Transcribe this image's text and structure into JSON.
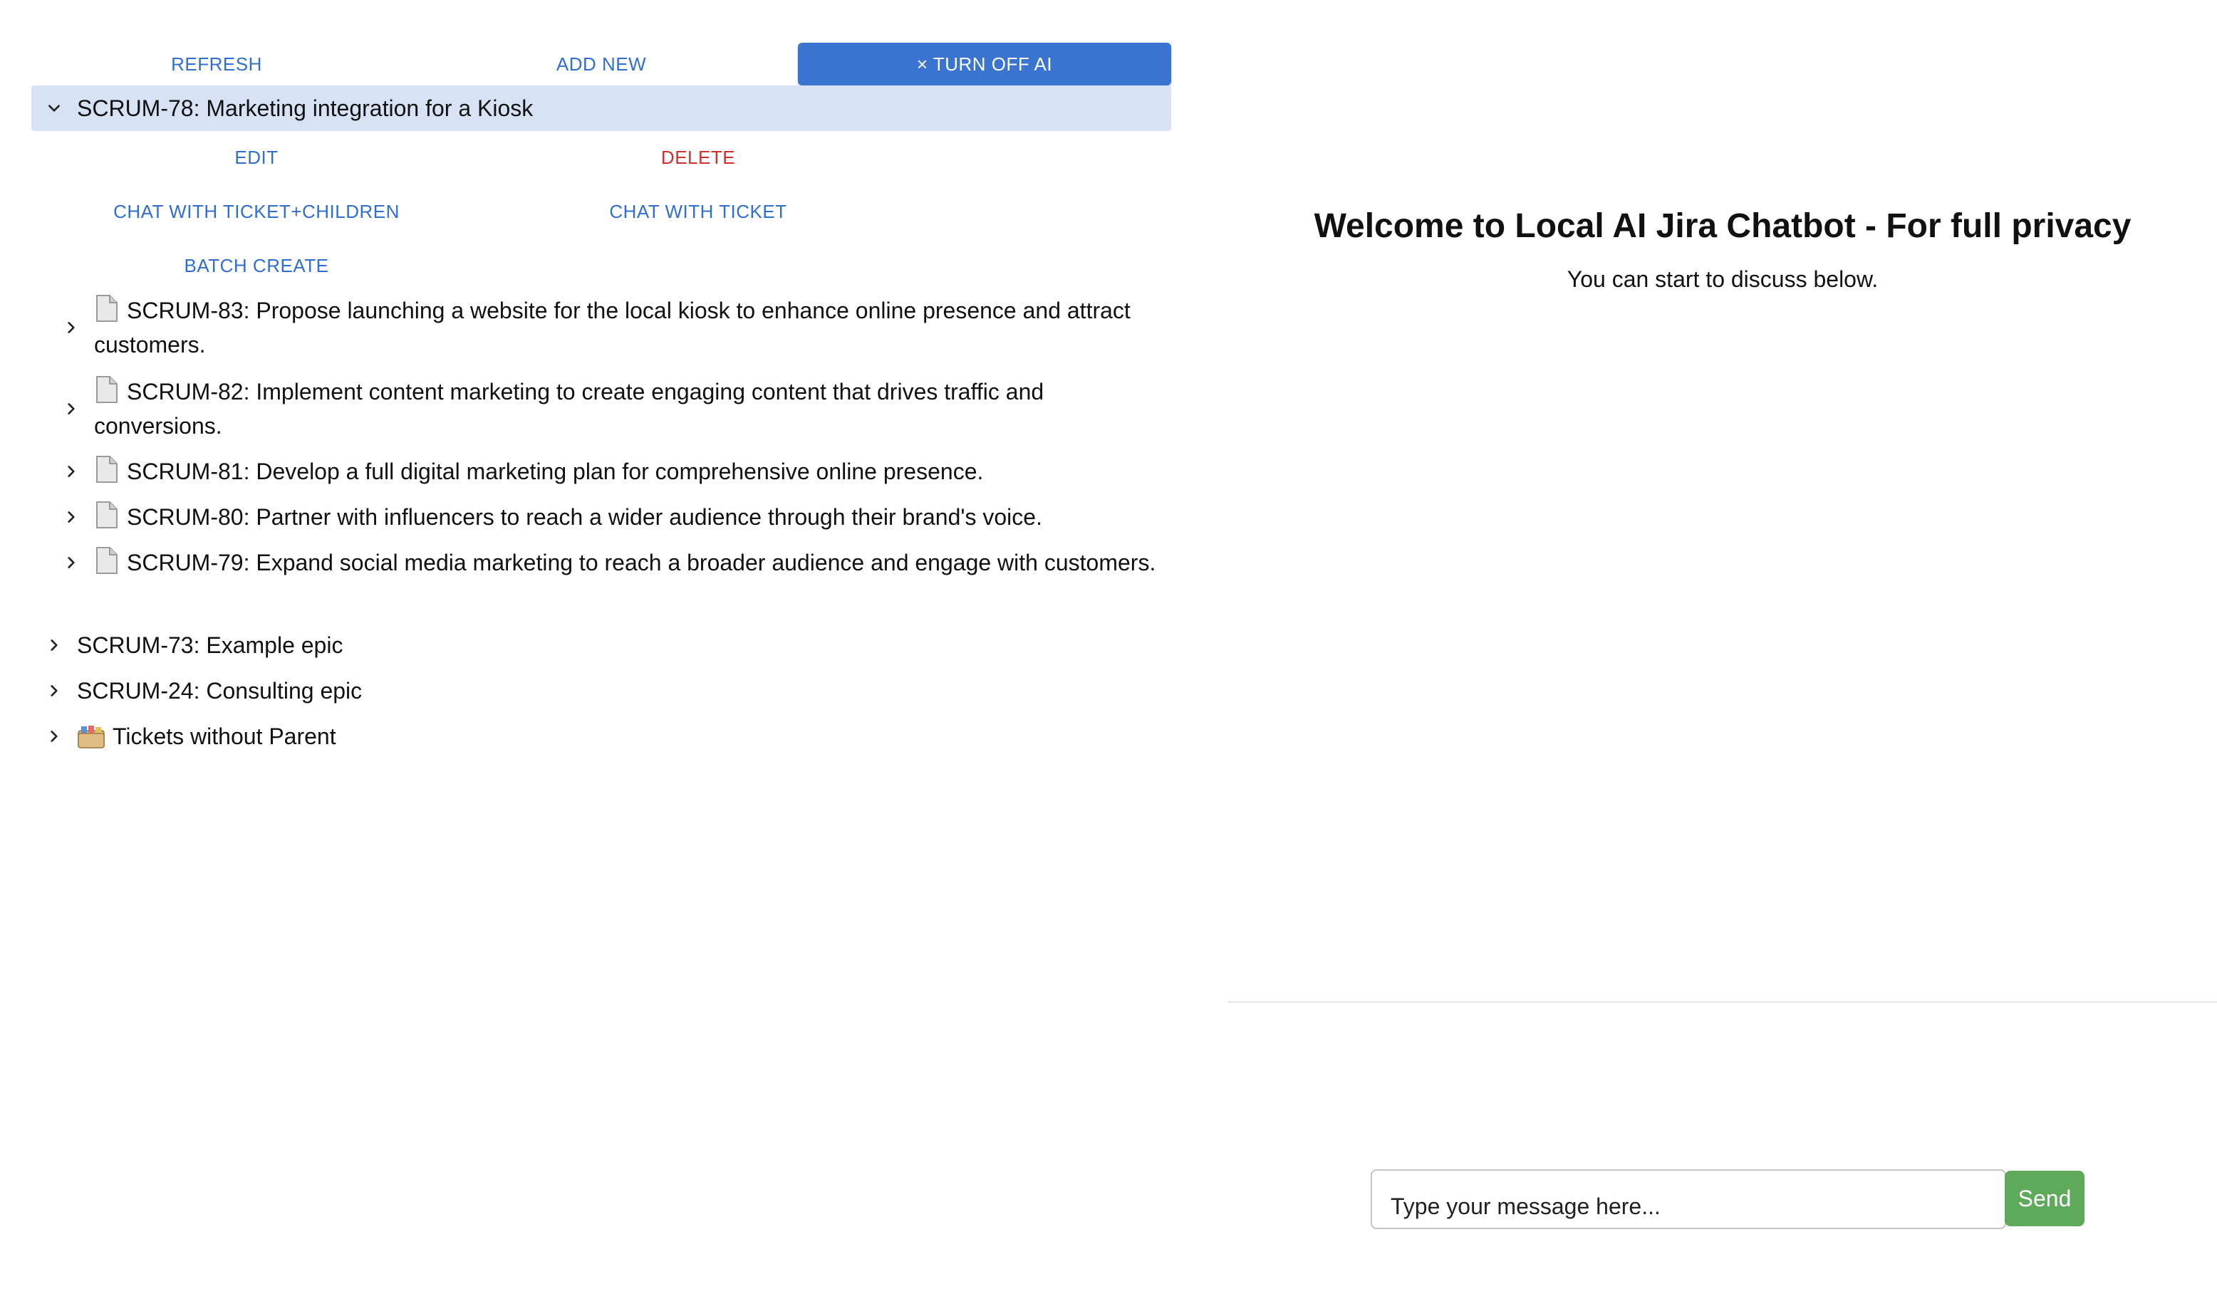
{
  "toolbar": {
    "refresh_label": "REFRESH",
    "add_new_label": "ADD NEW",
    "turn_off_ai_label": "× TURN OFF AI"
  },
  "tree": {
    "selected_epic": {
      "label": "SCRUM-78: Marketing integration for a Kiosk",
      "actions": {
        "edit": "EDIT",
        "delete": "DELETE",
        "chat_children": "CHAT WITH TICKET+CHILDREN",
        "chat_ticket": "CHAT WITH TICKET",
        "batch_create": "BATCH CREATE"
      },
      "children": [
        {
          "label": "SCRUM-83: Propose launching a website for the local kiosk to enhance online presence and attract customers."
        },
        {
          "label": "SCRUM-82: Implement content marketing to create engaging content that drives traffic and conversions."
        },
        {
          "label": "SCRUM-81: Develop a full digital marketing plan for comprehensive online presence."
        },
        {
          "label": "SCRUM-80: Partner with influencers to reach a wider audience through their brand's voice."
        },
        {
          "label": "SCRUM-79: Expand social media marketing to reach a broader audience and engage with customers."
        }
      ]
    },
    "other_epics": [
      {
        "label": "SCRUM-73: Example epic"
      },
      {
        "label": "SCRUM-24: Consulting epic"
      },
      {
        "label": "Tickets without Parent",
        "icon": "folder-icon"
      }
    ]
  },
  "chat": {
    "title": "Welcome to Local AI Jira Chatbot - For full privacy",
    "subtitle": "You can start to discuss below.",
    "input_placeholder": "Type your message here...",
    "send_label": "Send"
  },
  "colors": {
    "accent": "#3a74d1",
    "link": "#2f6fd0",
    "danger": "#d32f2f",
    "selected_bg": "#d7e3f5",
    "send_bg": "#5fa95a"
  }
}
